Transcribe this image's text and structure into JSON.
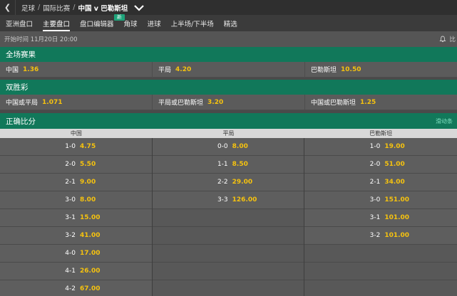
{
  "breadcrumb": {
    "items": [
      "足球",
      "国际比赛"
    ],
    "current": "中国 v 巴勒斯坦"
  },
  "tabs": [
    {
      "label": "亚洲盘口",
      "active": false
    },
    {
      "label": "主要盘口",
      "active": true
    },
    {
      "label": "盘口编辑器",
      "active": false,
      "badge": "新"
    },
    {
      "label": "角球",
      "active": false
    },
    {
      "label": "进球",
      "active": false
    },
    {
      "label": "上半场/下半场",
      "active": false
    },
    {
      "label": "精选",
      "active": false
    }
  ],
  "start_time": "开始时间 11月20日 20:00",
  "stats_label": "比",
  "full_time": {
    "title": "全场赛果",
    "selections": [
      {
        "name": "中国",
        "odds": "1.36"
      },
      {
        "name": "平局",
        "odds": "4.20"
      },
      {
        "name": "巴勒斯坦",
        "odds": "10.50"
      }
    ]
  },
  "double_chance": {
    "title": "双胜彩",
    "selections": [
      {
        "name": "中国或平局",
        "odds": "1.071"
      },
      {
        "name": "平局或巴勒斯坦",
        "odds": "3.20"
      },
      {
        "name": "中国或巴勒斯坦",
        "odds": "1.25"
      }
    ]
  },
  "correct_score": {
    "title": "正确比分",
    "side_link": "滑动条",
    "columns": [
      "中国",
      "平局",
      "巴勒斯坦"
    ],
    "home": [
      {
        "score": "1-0",
        "odds": "4.75"
      },
      {
        "score": "2-0",
        "odds": "5.50"
      },
      {
        "score": "2-1",
        "odds": "9.00"
      },
      {
        "score": "3-0",
        "odds": "8.00"
      },
      {
        "score": "3-1",
        "odds": "15.00"
      },
      {
        "score": "3-2",
        "odds": "41.00"
      },
      {
        "score": "4-0",
        "odds": "17.00"
      },
      {
        "score": "4-1",
        "odds": "26.00"
      },
      {
        "score": "4-2",
        "odds": "67.00"
      }
    ],
    "draw": [
      {
        "score": "0-0",
        "odds": "8.00"
      },
      {
        "score": "1-1",
        "odds": "8.50"
      },
      {
        "score": "2-2",
        "odds": "29.00"
      },
      {
        "score": "3-3",
        "odds": "126.00"
      }
    ],
    "away": [
      {
        "score": "1-0",
        "odds": "19.00"
      },
      {
        "score": "2-0",
        "odds": "51.00"
      },
      {
        "score": "2-1",
        "odds": "34.00"
      },
      {
        "score": "3-0",
        "odds": "151.00"
      },
      {
        "score": "3-1",
        "odds": "101.00"
      },
      {
        "score": "3-2",
        "odds": "101.00"
      }
    ]
  },
  "colors": {
    "header_green": "#11785a",
    "odds_yellow": "#f5c20f",
    "background": "#4a4a4a"
  }
}
